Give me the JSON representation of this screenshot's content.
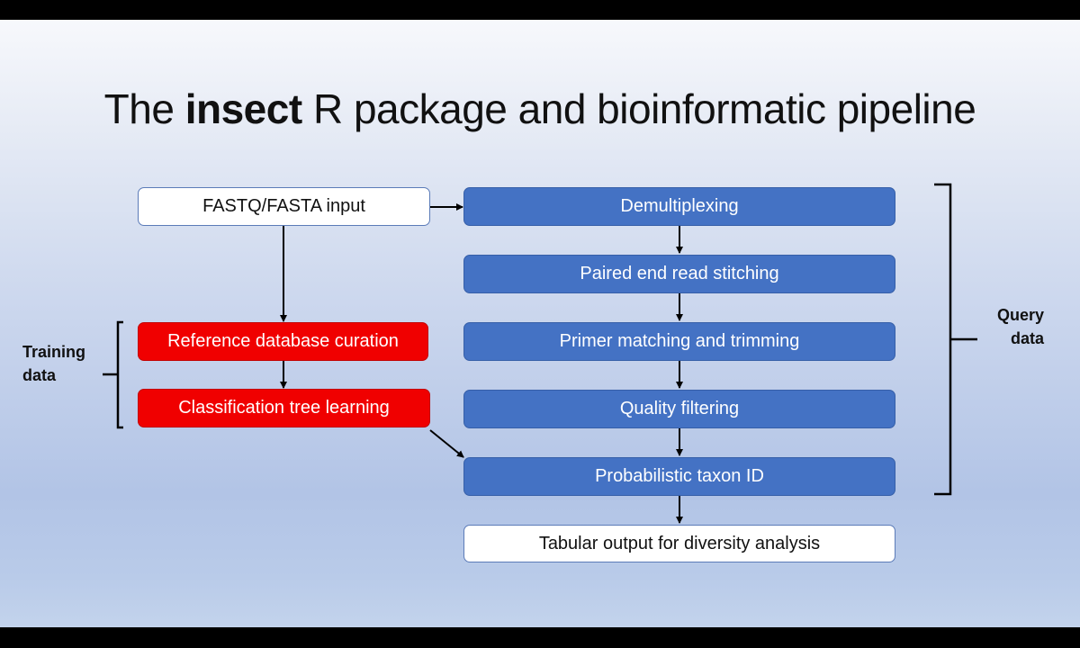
{
  "title": {
    "prefix": "The ",
    "bold": "insect",
    "suffix": " R package and bioinformatic pipeline"
  },
  "left_boxes": {
    "input": "FASTQ/FASTA input",
    "reference": "Reference database curation",
    "classification": "Classification tree learning"
  },
  "pipeline": [
    "Demultiplexing",
    "Paired end read stitching",
    "Primer matching and trimming",
    "Quality filtering",
    "Probabilistic taxon ID"
  ],
  "output": "Tabular output for diversity analysis",
  "labels": {
    "training": [
      "Training",
      "data"
    ],
    "query": [
      "Query",
      "data"
    ]
  },
  "colors": {
    "red_box": "#f00000",
    "blue_box": "#4472c4",
    "white_box": "#ffffff"
  }
}
